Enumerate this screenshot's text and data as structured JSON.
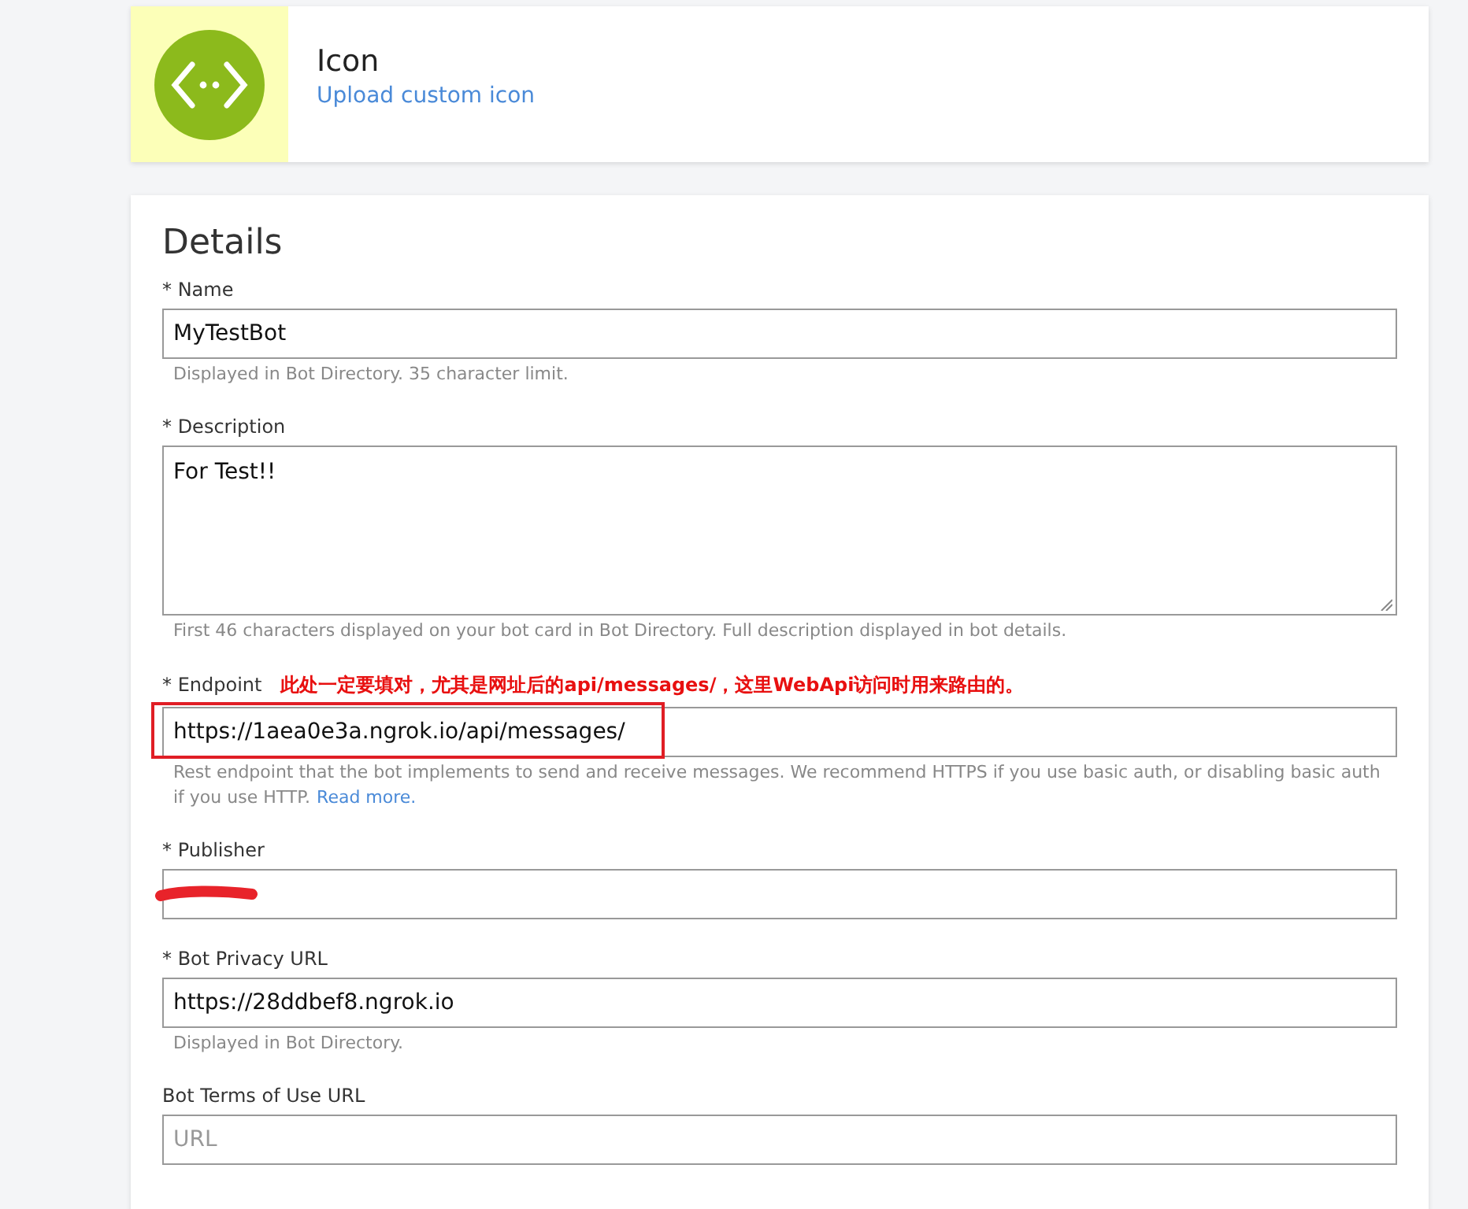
{
  "icon_card": {
    "title": "Icon",
    "link": "Upload custom icon"
  },
  "details": {
    "title": "Details",
    "fields": [
      {
        "kind": "input",
        "label": "* Name",
        "value": "MyTestBot",
        "hint": "Displayed in Bot Directory. 35 character limit."
      },
      {
        "kind": "textarea",
        "label": "* Description",
        "value": "For Test!!",
        "hint": "First 46 characters displayed on your bot card in Bot Directory. Full description displayed in bot details."
      },
      {
        "kind": "input",
        "label": "* Endpoint",
        "annotation": "此处一定要填对，尤其是网址后的api/messages/，这里WebApi访问时用来路由的。",
        "highlighted": true,
        "value": "https://1aea0e3a.ngrok.io/api/messages/",
        "hint": "Rest endpoint that the bot implements to send and receive messages. We recommend HTTPS if you use basic auth, or disabling basic auth if you use HTTP.",
        "hint_link": "Read more."
      },
      {
        "kind": "input",
        "label": "* Publisher",
        "redacted": true
      },
      {
        "kind": "input",
        "label": "* Bot Privacy URL",
        "value": "https://28ddbef8.ngrok.io",
        "hint": "Displayed in Bot Directory."
      },
      {
        "kind": "input",
        "label": "Bot Terms of Use URL",
        "placeholder": "URL"
      }
    ]
  }
}
